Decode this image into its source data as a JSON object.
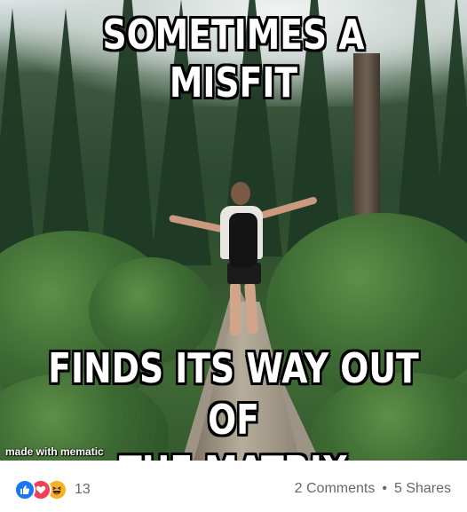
{
  "meme": {
    "top_text": "SOMETIMES A MISFIT",
    "bottom_line1": "FINDS ITS WAY OUT OF",
    "bottom_line2": "THE MATRIX",
    "watermark": "made with mematic"
  },
  "footer": {
    "reactions": [
      "like-icon",
      "love-icon",
      "haha-icon"
    ],
    "reaction_count": "13",
    "comments": "2 Comments",
    "separator": "•",
    "shares": "5 Shares"
  },
  "colors": {
    "like": "#1877f2",
    "love": "#f33e58",
    "haha": "#f7b125",
    "meta_text": "#65676b"
  }
}
